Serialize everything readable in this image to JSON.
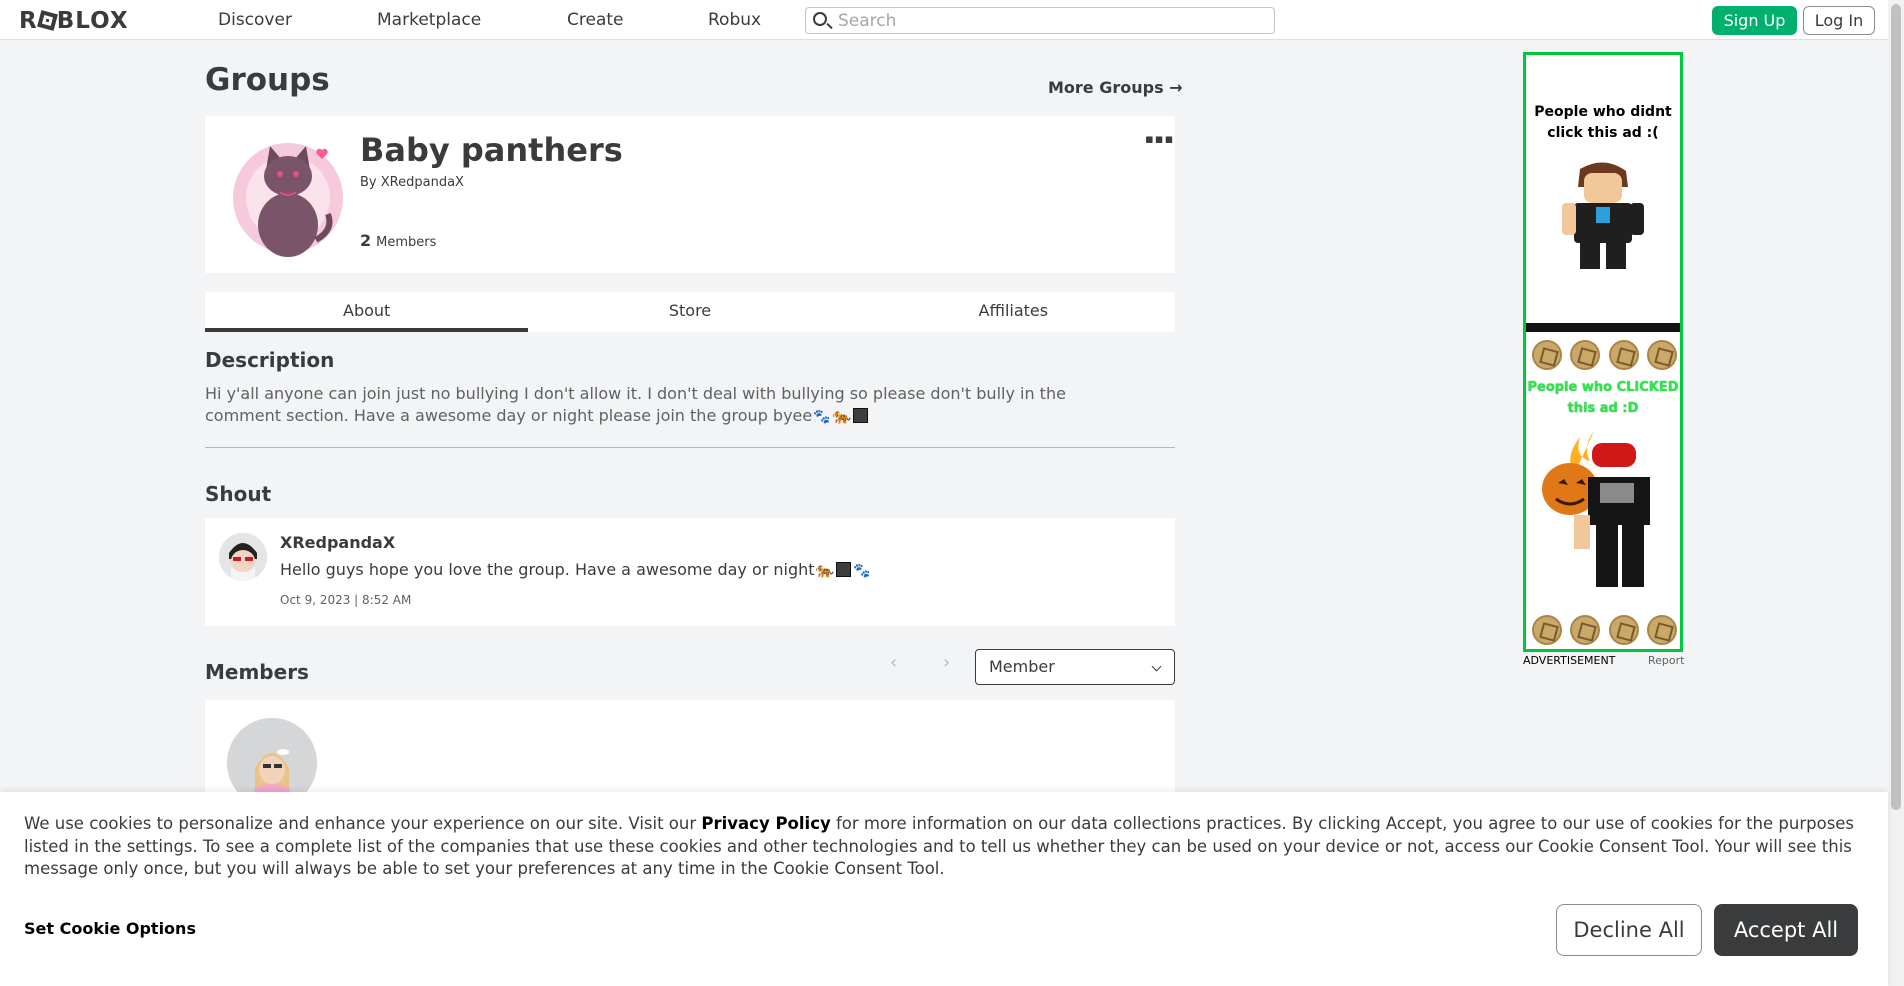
{
  "nav": {
    "logo": "ROBLOX",
    "links": [
      "Discover",
      "Marketplace",
      "Create",
      "Robux"
    ],
    "search_placeholder": "Search",
    "signup_label": "Sign Up",
    "login_label": "Log In"
  },
  "page": {
    "title": "Groups",
    "more_groups": "More Groups →"
  },
  "group": {
    "name": "Baby panthers",
    "by_label": "By",
    "owner": "XRedpandaX",
    "member_count": "2",
    "members_label": "Members",
    "more_icon": "more-dots-icon"
  },
  "tabs": [
    {
      "label": "About",
      "active": true
    },
    {
      "label": "Store",
      "active": false
    },
    {
      "label": "Affiliates",
      "active": false
    }
  ],
  "description": {
    "title": "Description",
    "text_line1": "Hi y'all anyone can join just no bullying I don't allow it. I don't deal with bullying so please don't bully in the",
    "text_line2": "comment section. Have a awesome day or night please join the group byee"
  },
  "shout": {
    "title": "Shout",
    "author": "XRedpandaX",
    "text": "Hello guys hope you love the group. Have a awesome day or night",
    "date": "Oct 9, 2023 | 8:52 AM"
  },
  "members": {
    "title": "Members",
    "role_selected": "Member"
  },
  "ad": {
    "top_text": "People who didnt click this ad :(",
    "green_text": "People who CLICKED this ad :D",
    "label": "ADVERTISEMENT",
    "report": "Report",
    "border_color": "#00c83c"
  },
  "cookie": {
    "text_before": "We use cookies to personalize and enhance your experience on our site. Visit our ",
    "privacy_link": "Privacy Policy",
    "text_after": " for more information on our data collections practices. By clicking Accept, you agree to our use of cookies for the purposes listed in the settings. To see a complete list of the companies that use these cookies and other technologies and to tell us whether they can be used on your device or not, access our Cookie Consent Tool. Your will see this message only once, but you will always be able to set your preferences at any time in the Cookie Consent Tool.",
    "options_label": "Set Cookie Options",
    "decline_label": "Decline All",
    "accept_label": "Accept All"
  },
  "colors": {
    "signup": "#00b06f",
    "accept": "#393b3d",
    "background": "#f2f4f5"
  }
}
